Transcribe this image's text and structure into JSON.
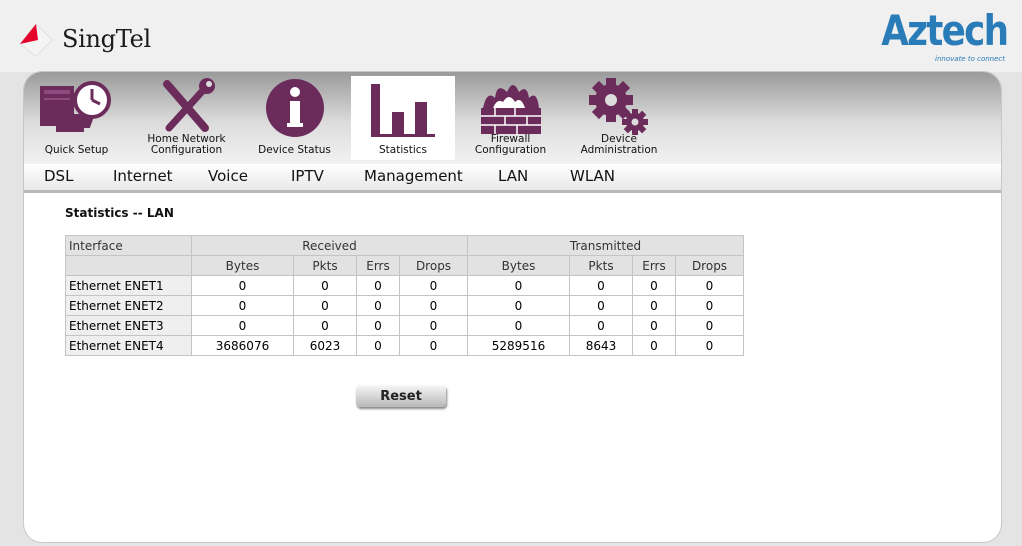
{
  "brand": {
    "singtel": "SingTel",
    "aztech": "Aztech",
    "aztech_tagline": "innovate to connect"
  },
  "nav_tabs": [
    {
      "label": "Quick Setup",
      "icon": "computer-clock-icon"
    },
    {
      "label": "Home Network Configuration",
      "icon": "wrench-screwdriver-icon"
    },
    {
      "label": "Device Status",
      "icon": "info-icon"
    },
    {
      "label": "Statistics",
      "icon": "bar-chart-icon",
      "active": true
    },
    {
      "label": "Firewall Configuration",
      "icon": "firewall-icon"
    },
    {
      "label": "Device Administration",
      "icon": "gears-icon"
    }
  ],
  "sub_nav": [
    "DSL",
    "Internet",
    "Voice",
    "IPTV",
    "Management",
    "LAN",
    "WLAN"
  ],
  "page_title": "Statistics -- LAN",
  "table": {
    "interface_header": "Interface",
    "received_header": "Received",
    "transmitted_header": "Transmitted",
    "sub_headers": [
      "Bytes",
      "Pkts",
      "Errs",
      "Drops",
      "Bytes",
      "Pkts",
      "Errs",
      "Drops"
    ],
    "rows": [
      {
        "name": "Ethernet ENET1",
        "values": [
          "0",
          "0",
          "0",
          "0",
          "0",
          "0",
          "0",
          "0"
        ]
      },
      {
        "name": "Ethernet ENET2",
        "values": [
          "0",
          "0",
          "0",
          "0",
          "0",
          "0",
          "0",
          "0"
        ]
      },
      {
        "name": "Ethernet ENET3",
        "values": [
          "0",
          "0",
          "0",
          "0",
          "0",
          "0",
          "0",
          "0"
        ]
      },
      {
        "name": "Ethernet ENET4",
        "values": [
          "3686076",
          "6023",
          "0",
          "0",
          "5289516",
          "8643",
          "0",
          "0"
        ]
      }
    ]
  },
  "reset_label": "Reset",
  "colors": {
    "icon_purple": "#6b2c5c",
    "aztech_blue": "#2a7cb8",
    "singtel_red": "#e4002b"
  }
}
